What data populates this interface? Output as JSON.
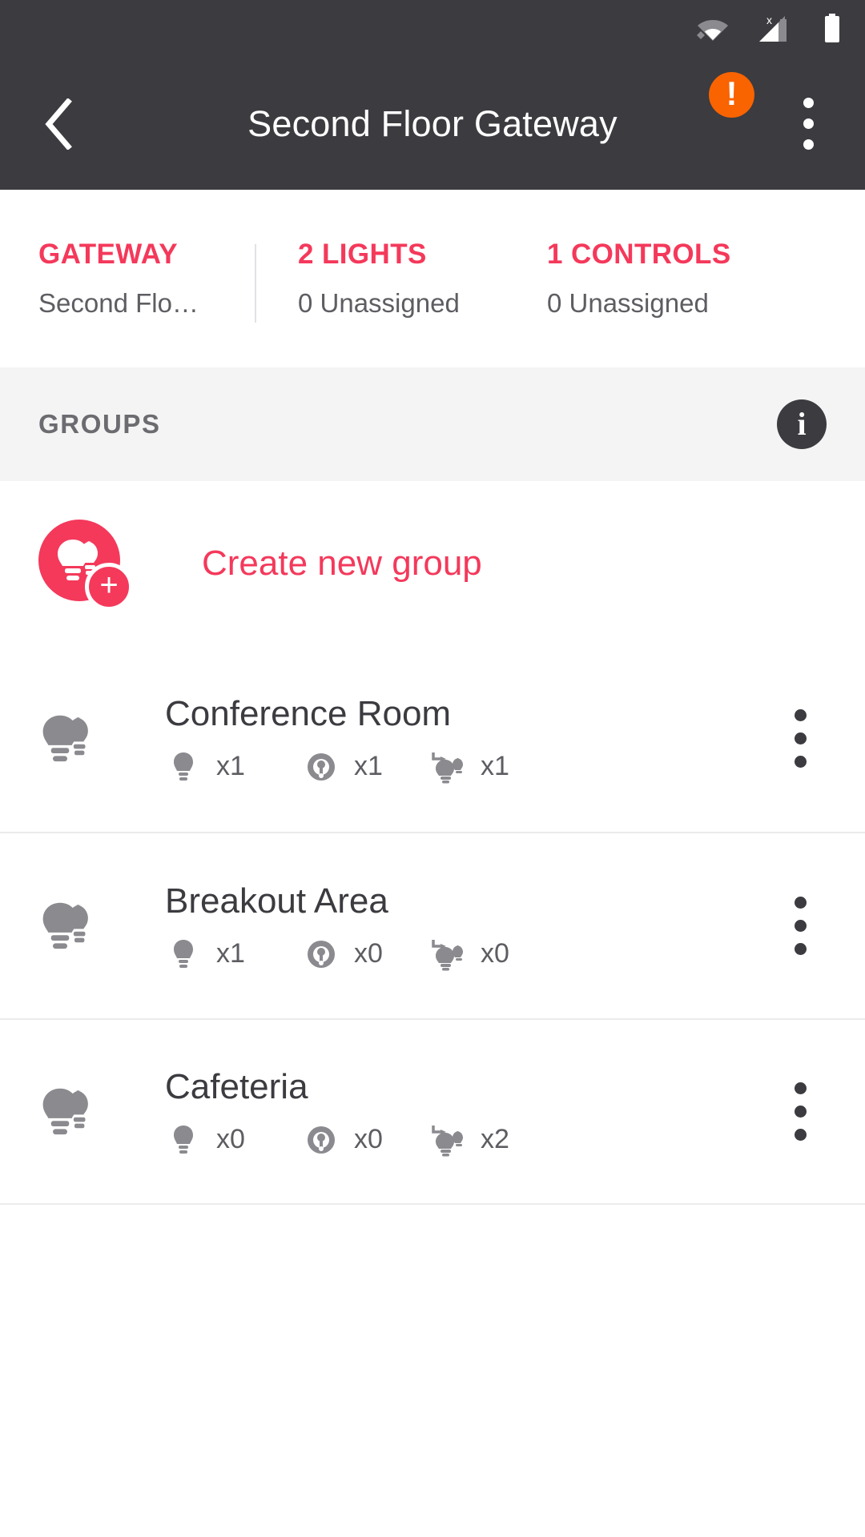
{
  "statusbar": {
    "icons": [
      {
        "name": "wifi-icon",
        "label": "Wi-Fi connected"
      },
      {
        "name": "cellular-no-sim-icon",
        "label": "X"
      },
      {
        "name": "battery-icon",
        "label": "Battery full"
      }
    ]
  },
  "appbar": {
    "back_label": "Back",
    "title": "Second Floor Gateway",
    "alert_glyph": "!",
    "alert_color": "#f96300",
    "overflow_label": "More options"
  },
  "stats": [
    {
      "title": "GATEWAY",
      "sub": "Second Flo…"
    },
    {
      "title": "2 LIGHTS",
      "sub": "0 Unassigned"
    },
    {
      "title": "1 CONTROLS",
      "sub": "0 Unassigned"
    }
  ],
  "groups_band": {
    "label": "GROUPS",
    "info_glyph": "i"
  },
  "create_group": {
    "label": "Create new group",
    "plus_glyph": "+"
  },
  "groups": [
    {
      "name": "Conference Room",
      "counts": [
        {
          "icon": "bulb-icon",
          "value": "x1"
        },
        {
          "icon": "dial-control-icon",
          "value": "x1"
        },
        {
          "icon": "scene-bulb-icon",
          "value": "x1"
        }
      ]
    },
    {
      "name": "Breakout Area",
      "counts": [
        {
          "icon": "bulb-icon",
          "value": "x1"
        },
        {
          "icon": "dial-control-icon",
          "value": "x0"
        },
        {
          "icon": "scene-bulb-icon",
          "value": "x0"
        }
      ]
    },
    {
      "name": "Cafeteria",
      "counts": [
        {
          "icon": "bulb-icon",
          "value": "x0"
        },
        {
          "icon": "dial-control-icon",
          "value": "x0"
        },
        {
          "icon": "scene-bulb-icon",
          "value": "x2"
        }
      ]
    }
  ],
  "colors": {
    "accent": "#f4395b",
    "header": "#3b3b40",
    "alert": "#f96300",
    "band": "#f4f4f4",
    "muted_text": "#5d5d62"
  }
}
